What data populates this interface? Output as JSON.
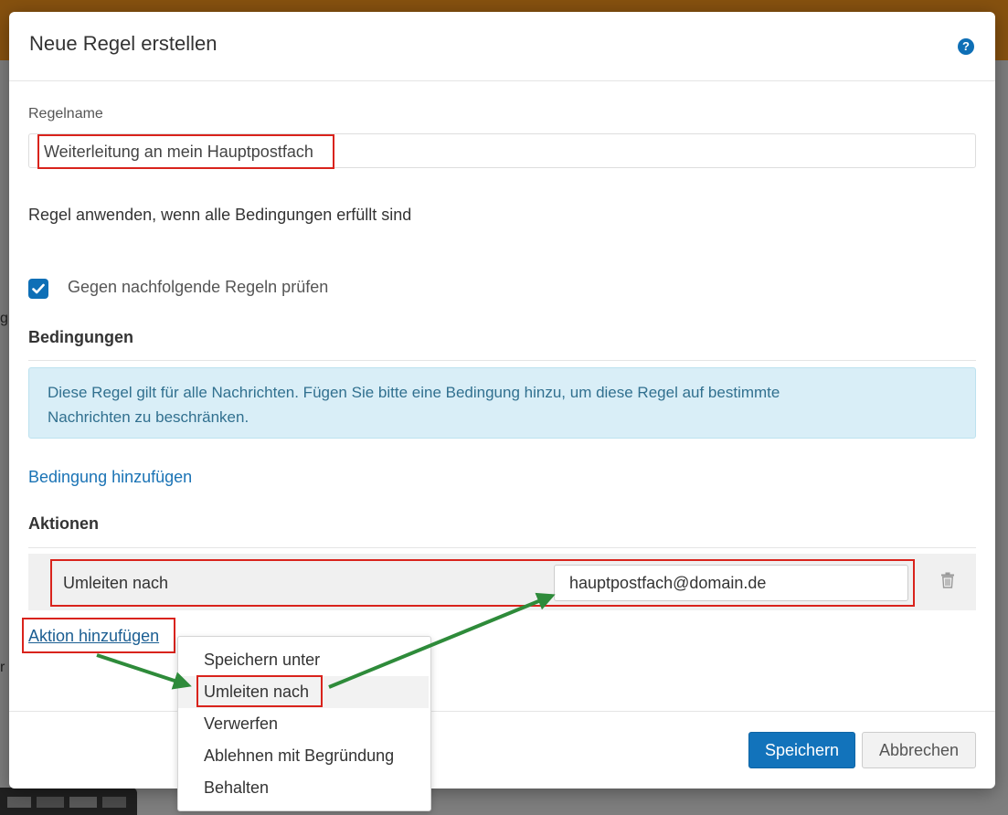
{
  "modal": {
    "title": "Neue Regel erstellen",
    "help_icon": "help-icon"
  },
  "rule_name": {
    "label": "Regelname",
    "value": "Weiterleitung an mein Hauptpostfach"
  },
  "apply_text": "Regel anwenden, wenn alle Bedingungen erfüllt sind",
  "check_following": {
    "label": "Gegen nachfolgende Regeln prüfen",
    "checked": true
  },
  "conditions": {
    "title": "Bedingungen",
    "info_line1": "Diese Regel gilt für alle Nachrichten. Fügen Sie bitte eine Bedingung hinzu, um diese Regel auf bestimmte",
    "info_line2": "Nachrichten zu beschränken.",
    "add_link": "Bedingung hinzufügen"
  },
  "actions": {
    "title": "Aktionen",
    "row": {
      "action_label": "Umleiten nach",
      "target_value": "hauptpostfach@domain.de",
      "delete_icon": "trash-icon"
    },
    "add_link": "Aktion hinzufügen"
  },
  "dropdown": {
    "items": [
      "Speichern unter",
      "Umleiten nach",
      "Verwerfen",
      "Ablehnen mit Begründung",
      "Behalten"
    ],
    "highlighted": "Umleiten nach"
  },
  "footer": {
    "save_label": "Speichern",
    "cancel_label": "Abbrechen"
  },
  "colors": {
    "accent": "#1273bb",
    "highlight_box": "#d9231c",
    "annotation_arrow": "#2e8b3a"
  }
}
